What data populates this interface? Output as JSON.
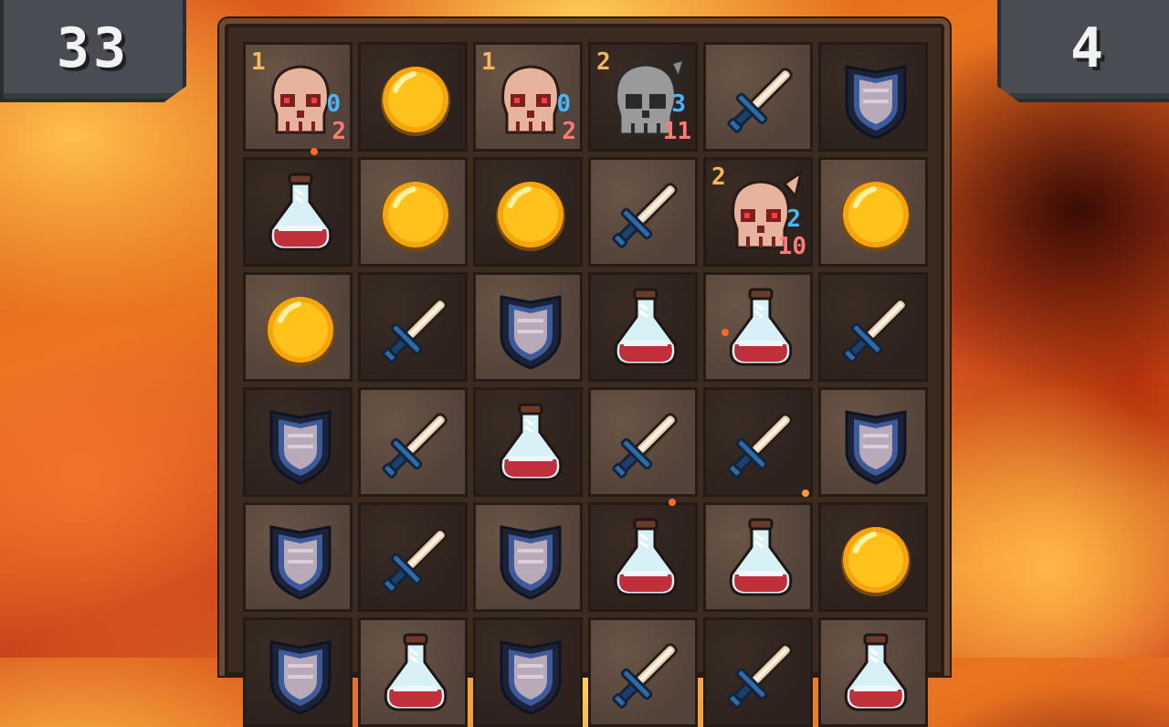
{
  "hud": {
    "score_left": "33",
    "score_right": "4"
  },
  "board": {
    "rows": [
      [
        {
          "type": "skull",
          "level": "1",
          "defense": "0",
          "hp": "2"
        },
        {
          "type": "coin"
        },
        {
          "type": "skull",
          "level": "1",
          "defense": "0",
          "hp": "2"
        },
        {
          "type": "skull-helmet",
          "level": "2",
          "defense": "3",
          "hp": "11"
        },
        {
          "type": "sword"
        },
        {
          "type": "shield"
        }
      ],
      [
        {
          "type": "potion"
        },
        {
          "type": "coin"
        },
        {
          "type": "coin"
        },
        {
          "type": "sword"
        },
        {
          "type": "skull-horned",
          "level": "2",
          "defense": "2",
          "hp": "10"
        },
        {
          "type": "coin"
        }
      ],
      [
        {
          "type": "coin"
        },
        {
          "type": "sword"
        },
        {
          "type": "shield"
        },
        {
          "type": "potion"
        },
        {
          "type": "potion"
        },
        {
          "type": "sword"
        }
      ],
      [
        {
          "type": "shield"
        },
        {
          "type": "sword"
        },
        {
          "type": "potion"
        },
        {
          "type": "sword"
        },
        {
          "type": "sword"
        },
        {
          "type": "shield"
        }
      ],
      [
        {
          "type": "shield"
        },
        {
          "type": "sword"
        },
        {
          "type": "shield"
        },
        {
          "type": "potion"
        },
        {
          "type": "potion"
        },
        {
          "type": "coin"
        }
      ],
      [
        {
          "type": "shield"
        },
        {
          "type": "potion"
        },
        {
          "type": "shield"
        },
        {
          "type": "sword"
        },
        {
          "type": "sword"
        },
        {
          "type": "potion"
        }
      ]
    ]
  },
  "colors": {
    "background": "#d8521b",
    "tile_light": "#5e4a3e",
    "tile_dark": "#33271f",
    "defense": "#44b8ff",
    "hp": "#ff7b74",
    "level": "#f7b85a"
  }
}
